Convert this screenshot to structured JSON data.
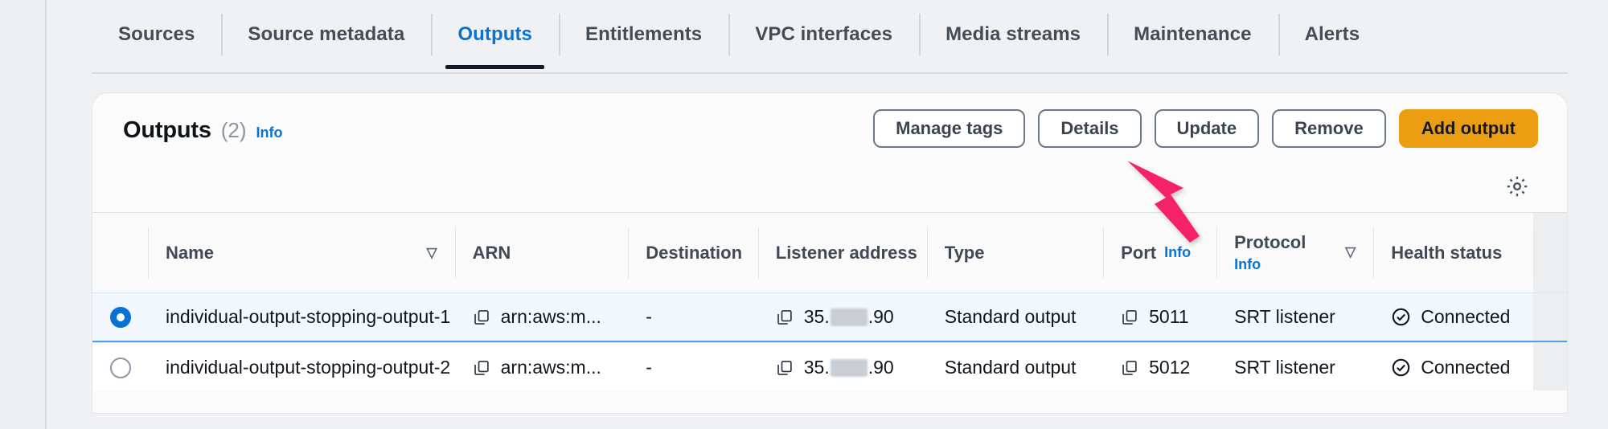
{
  "tabs": [
    {
      "label": "Sources",
      "active": false
    },
    {
      "label": "Source metadata",
      "active": false
    },
    {
      "label": "Outputs",
      "active": true
    },
    {
      "label": "Entitlements",
      "active": false
    },
    {
      "label": "VPC interfaces",
      "active": false
    },
    {
      "label": "Media streams",
      "active": false
    },
    {
      "label": "Maintenance",
      "active": false
    },
    {
      "label": "Alerts",
      "active": false
    }
  ],
  "panel": {
    "title": "Outputs",
    "count": "(2)",
    "info_label": "Info",
    "settings_icon": "gear-icon"
  },
  "actions": [
    {
      "label": "Manage tags",
      "primary": false
    },
    {
      "label": "Details",
      "primary": false
    },
    {
      "label": "Update",
      "primary": false
    },
    {
      "label": "Remove",
      "primary": false
    },
    {
      "label": "Add output",
      "primary": true
    }
  ],
  "table": {
    "columns": [
      {
        "label": "Name",
        "sortable": true,
        "info": false
      },
      {
        "label": "ARN",
        "sortable": false,
        "info": false
      },
      {
        "label": "Destination",
        "sortable": false,
        "info": false
      },
      {
        "label": "Listener address",
        "sortable": false,
        "info": false
      },
      {
        "label": "Type",
        "sortable": false,
        "info": false
      },
      {
        "label": "Port",
        "sortable": false,
        "info": true,
        "info_label": "Info"
      },
      {
        "label": "Protocol",
        "sortable": true,
        "info": true,
        "info_label": "Info"
      },
      {
        "label": "Health status",
        "sortable": false,
        "info": false
      }
    ],
    "sort_icon": "sort-descending-icon",
    "rows": [
      {
        "selected": true,
        "name": "individual-output-stopping-output-1",
        "arn": "arn:aws:m...",
        "destination": "-",
        "listener_address_prefix": "35.",
        "listener_address_suffix": ".90",
        "type": "Standard output",
        "port": "5011",
        "protocol": "SRT listener",
        "health_status": "Connected"
      },
      {
        "selected": false,
        "name": "individual-output-stopping-output-2",
        "arn": "arn:aws:m...",
        "destination": "-",
        "listener_address_prefix": "35.",
        "listener_address_suffix": ".90",
        "type": "Standard output",
        "port": "5012",
        "protocol": "SRT listener",
        "health_status": "Connected"
      }
    ]
  },
  "annotation": {
    "arrow_color": "#f5246a",
    "points_at": "Update"
  },
  "colors": {
    "accent_link": "#0972d3",
    "primary_button": "#ec9e12",
    "selected_row": "#f2f8fd",
    "arrow": "#f5246a"
  }
}
